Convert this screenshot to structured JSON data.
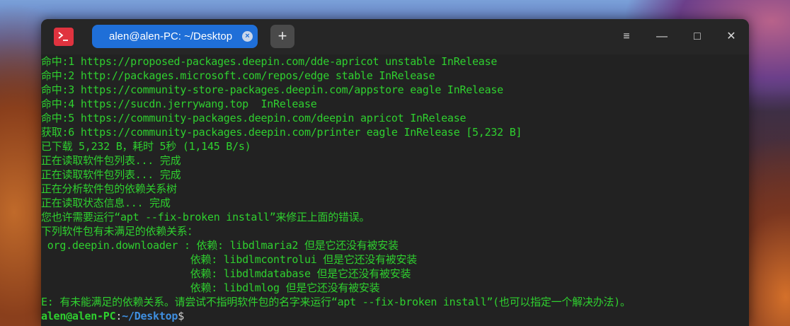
{
  "window": {
    "tab_title": "alen@alen-PC: ~/Desktop",
    "tab_close_glyph": "×",
    "new_tab_glyph": "+",
    "menu_glyph": "≡",
    "minimize_glyph": "—",
    "maximize_glyph": "□",
    "close_glyph": "✕"
  },
  "terminal": {
    "output_lines": [
      "命中:1 https://proposed-packages.deepin.com/dde-apricot unstable InRelease",
      "命中:2 http://packages.microsoft.com/repos/edge stable InRelease",
      "命中:3 https://community-store-packages.deepin.com/appstore eagle InRelease",
      "命中:4 https://sucdn.jerrywang.top  InRelease",
      "命中:5 https://community-packages.deepin.com/deepin apricot InRelease",
      "获取:6 https://community-packages.deepin.com/printer eagle InRelease [5,232 B]",
      "已下载 5,232 B，耗时 5秒 (1,145 B/s)",
      "正在读取软件包列表... 完成",
      "正在读取软件包列表... 完成",
      "正在分析软件包的依赖关系树",
      "正在读取状态信息... 完成",
      "您也许需要运行“apt --fix-broken install”来修正上面的错误。",
      "下列软件包有未满足的依赖关系：",
      " org.deepin.downloader : 依赖: libdlmaria2 但是它还没有被安装",
      "                        依赖: libdlmcontrolui 但是它还没有被安装",
      "                        依赖: libdlmdatabase 但是它还没有被安装",
      "                        依赖: libdlmlog 但是它还没有被安装",
      "E: 有未能满足的依赖关系。请尝试不指明软件包的名字来运行“apt --fix-broken install”(也可以指定一个解决办法)。"
    ],
    "prompt": {
      "user_host": "alen@alen-PC",
      "separator": ":",
      "path": "~/Desktop",
      "symbol": "$"
    }
  },
  "colors": {
    "terminal_text": "#2fd02f",
    "tab_active": "#1f6fd8",
    "app_icon": "#e0333f",
    "prompt_path": "#3f8fe0"
  }
}
